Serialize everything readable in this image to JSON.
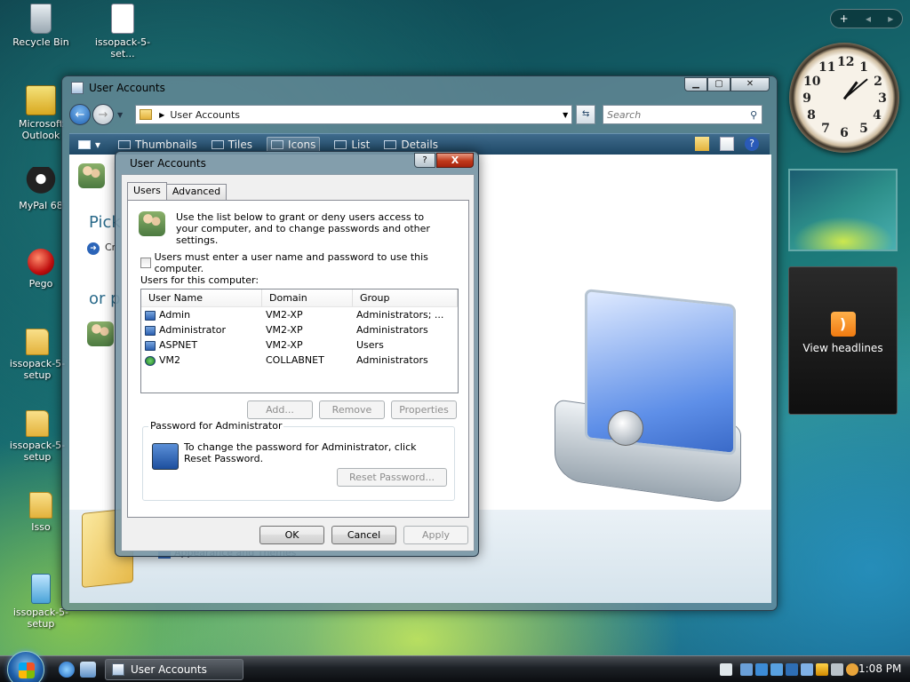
{
  "desktop": {
    "icons": [
      {
        "label": "Recycle Bin"
      },
      {
        "label": "issopack-5-set..."
      },
      {
        "label": "Microsoft Outlook"
      },
      {
        "label": "MyPal 68"
      },
      {
        "label": "Pego"
      },
      {
        "label": "issopack-5-setup"
      },
      {
        "label": "issopack-5-setup"
      },
      {
        "label": "Isso"
      },
      {
        "label": "issopack-5-setup"
      }
    ]
  },
  "sidebar": {
    "bar_add": "+",
    "bar_prev": "◂",
    "bar_next": "▸",
    "clock_numbers": [
      "12",
      "1",
      "2",
      "3",
      "4",
      "5",
      "6",
      "7",
      "8",
      "9",
      "10",
      "11"
    ],
    "feed_label": "View headlines"
  },
  "main_window": {
    "title": "User Accounts",
    "address": "User Accounts",
    "search_placeholder": "Search",
    "toolbar": [
      "Thumbnails",
      "Tiles",
      "Icons",
      "List",
      "Details"
    ],
    "pick_text": "Pick",
    "create_text": "Cr",
    "or_text": "or p",
    "appearance": "Appearance and Themes"
  },
  "dialog": {
    "title": "User Accounts",
    "help_label": "?",
    "close_label": "X",
    "tabs": [
      "Users",
      "Advanced"
    ],
    "intro": "Use the list below to grant or deny users access to your computer, and to change passwords and other settings.",
    "checkbox_label": "Users must enter a user name and password to use this computer.",
    "checkbox_checked": false,
    "users_label": "Users for this computer:",
    "columns": [
      "User Name",
      "Domain",
      "Group"
    ],
    "rows": [
      {
        "name": "Admin",
        "domain": "VM2-XP",
        "group": "Administrators; ..."
      },
      {
        "name": "Administrator",
        "domain": "VM2-XP",
        "group": "Administrators"
      },
      {
        "name": "ASPNET",
        "domain": "VM2-XP",
        "group": "Users"
      },
      {
        "name": "VM2",
        "domain": "COLLABNET",
        "group": "Administrators"
      }
    ],
    "add_button": "Add...",
    "remove_button": "Remove",
    "properties_button": "Properties",
    "password_group": "Password for Administrator",
    "password_text": "To change the password for Administrator, click Reset Password.",
    "reset_button": "Reset Password...",
    "ok_button": "OK",
    "cancel_button": "Cancel",
    "apply_button": "Apply"
  },
  "taskbar": {
    "active_task": "User Accounts",
    "time": "1:08 PM"
  }
}
